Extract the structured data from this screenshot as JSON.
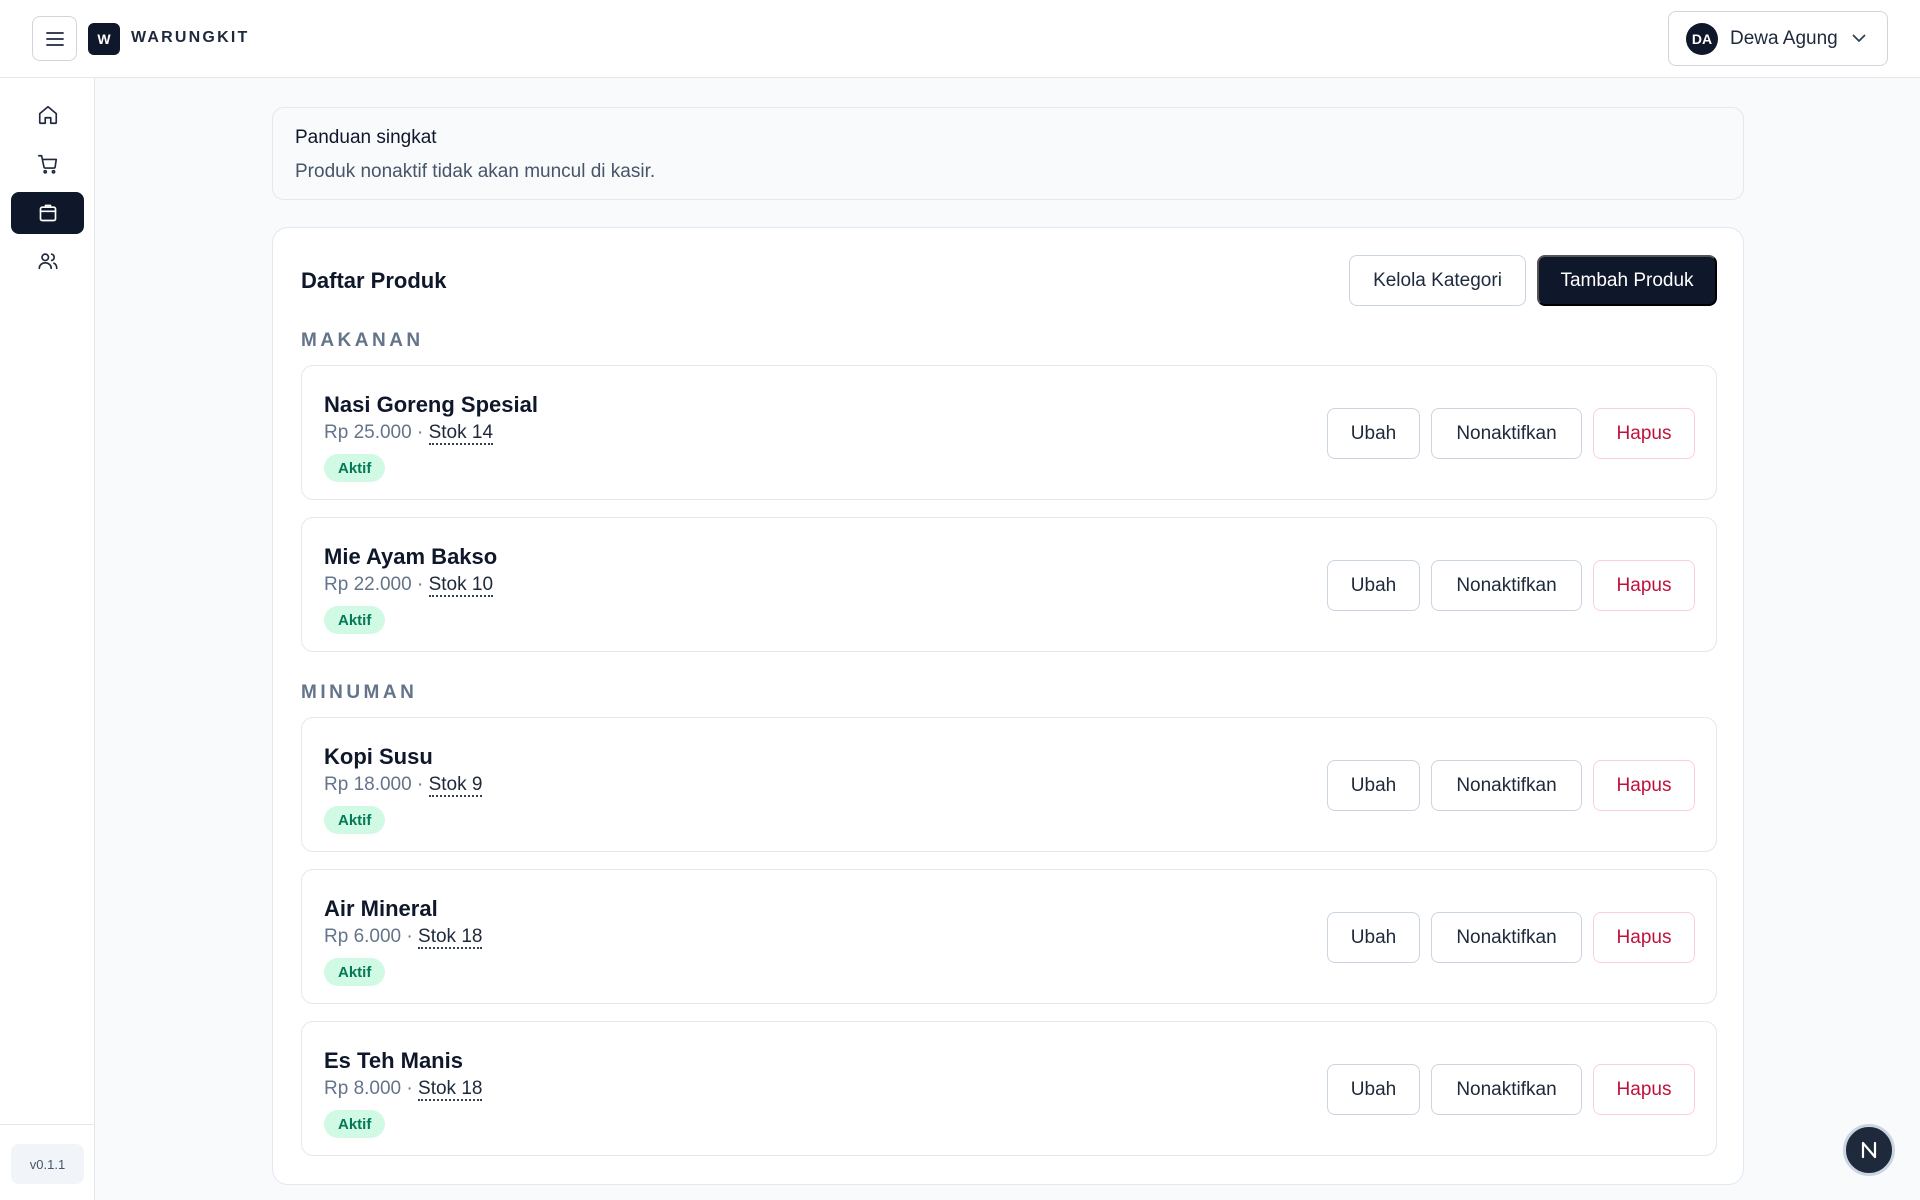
{
  "header": {
    "menu_icon": "hamburger-icon",
    "logo_letter": "W",
    "brand": "WARUNGKIT",
    "user": {
      "initials": "DA",
      "name": "Dewa Agung",
      "chevron_icon": "chevron-down-icon"
    }
  },
  "sidebar": {
    "items": [
      {
        "icon": "home-icon",
        "active": false
      },
      {
        "icon": "cart-icon",
        "active": false
      },
      {
        "icon": "box-icon",
        "active": true
      },
      {
        "icon": "users-icon",
        "active": false
      }
    ],
    "version": "v0.1.1"
  },
  "guide": {
    "title": "Panduan singkat",
    "text": "Produk nonaktif tidak akan muncul di kasir."
  },
  "products_card": {
    "title": "Daftar Produk",
    "manage_categories_label": "Kelola Kategori",
    "add_product_label": "Tambah Produk",
    "actions": {
      "edit": "Ubah",
      "deactivate": "Nonaktifkan",
      "delete": "Hapus"
    },
    "sections": [
      {
        "label": "MAKANAN",
        "products": [
          {
            "name": "Nasi Goreng Spesial",
            "price": "Rp 25.000",
            "separator": " · ",
            "stock": "Stok 14",
            "status": "Aktif"
          },
          {
            "name": "Mie Ayam Bakso",
            "price": "Rp 22.000",
            "separator": " · ",
            "stock": "Stok 10",
            "status": "Aktif"
          }
        ]
      },
      {
        "label": "MINUMAN",
        "products": [
          {
            "name": "Kopi Susu",
            "price": "Rp 18.000",
            "separator": " · ",
            "stock": "Stok 9",
            "status": "Aktif"
          },
          {
            "name": "Air Mineral",
            "price": "Rp 6.000",
            "separator": " · ",
            "stock": "Stok 18",
            "status": "Aktif"
          },
          {
            "name": "Es Teh Manis",
            "price": "Rp 8.000",
            "separator": " · ",
            "stock": "Stok 18",
            "status": "Aktif"
          }
        ]
      }
    ]
  },
  "fab": {
    "letter": "N"
  },
  "colors": {
    "primary": "#0f172a",
    "active_badge_bg": "#d1fae5",
    "active_badge_text": "#047857",
    "danger": "#be123c"
  }
}
